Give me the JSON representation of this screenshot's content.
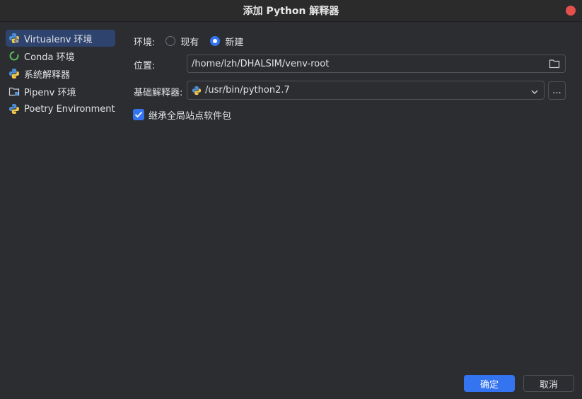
{
  "window": {
    "title": "添加 Python 解释器"
  },
  "sidebar": {
    "items": [
      {
        "label": "Virtualenv 环境",
        "icon": "python-venv-icon",
        "selected": true
      },
      {
        "label": "Conda 环境",
        "icon": "conda-icon",
        "selected": false
      },
      {
        "label": "系统解释器",
        "icon": "python-icon",
        "selected": false
      },
      {
        "label": "Pipenv 环境",
        "icon": "pipenv-folder-icon",
        "selected": false
      },
      {
        "label": "Poetry Environment",
        "icon": "poetry-icon",
        "selected": false
      }
    ]
  },
  "form": {
    "env_label": "环境:",
    "env_options": [
      {
        "label": "现有",
        "selected": false
      },
      {
        "label": "新建",
        "selected": true
      }
    ],
    "location_label": "位置:",
    "location_value": "/home/lzh/DHALSIM/venv-root",
    "base_label": "基础解释器:",
    "base_value": "/usr/bin/python2.7",
    "browse_label": "...",
    "inherit_label": "继承全局站点软件包",
    "inherit_checked": true
  },
  "footer": {
    "ok_label": "确定",
    "cancel_label": "取消"
  },
  "colors": {
    "accent": "#3574f0",
    "selection": "#2e436e",
    "close": "#e5504d"
  }
}
